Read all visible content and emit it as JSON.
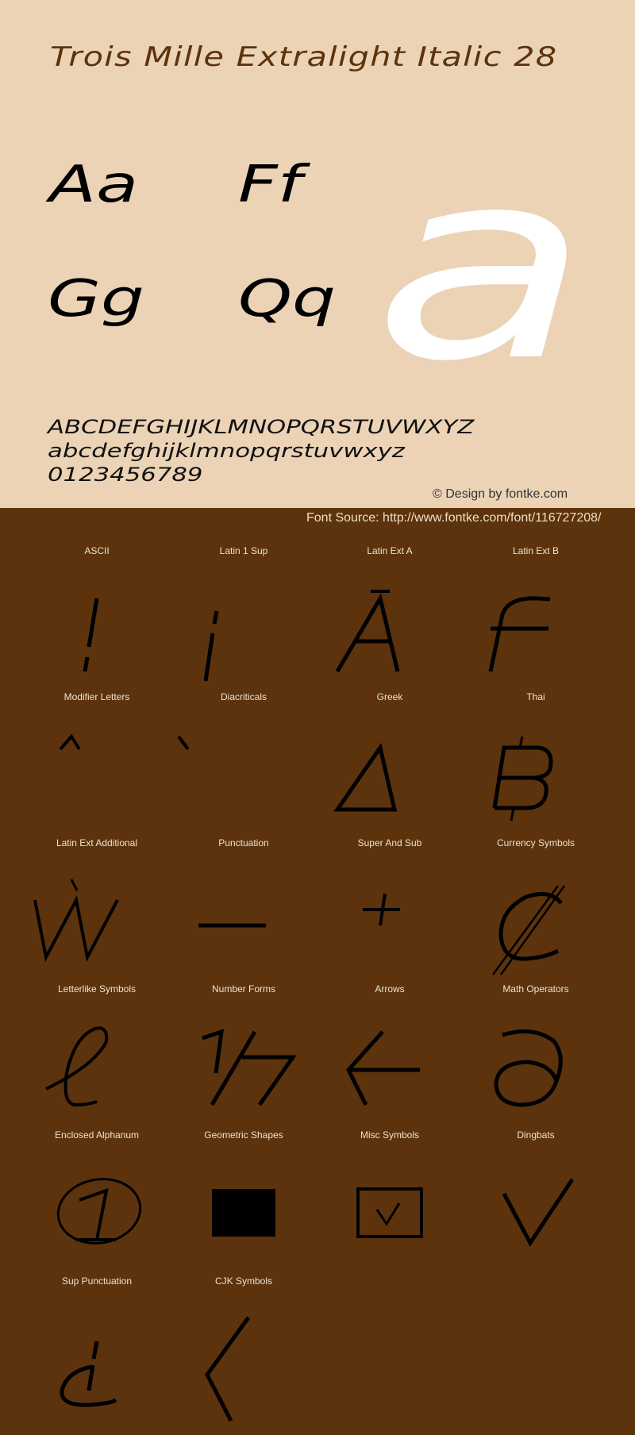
{
  "header": {
    "title": "Trois Mille Extralight Italic 28"
  },
  "specimen": {
    "pairs": [
      "Aa",
      "Ff",
      "Gg",
      "Qq"
    ],
    "large_glyph": "a",
    "uppercase": "ABCDEFGHIJKLMNOPQRSTUVWXYZ",
    "lowercase": "abcdefghijklmnopqrstuvwxyz",
    "digits": "0123456789",
    "credit": "© Design by fontke.com"
  },
  "source": {
    "text": "Font Source: http://www.fontke.com/font/116727208/"
  },
  "colors": {
    "top_background": "#ecd3b6",
    "bottom_background": "#5c330c",
    "title_color": "#5c330c",
    "large_glyph_color": "#ffffff"
  },
  "categories": [
    {
      "label": "ASCII",
      "glyph": "!"
    },
    {
      "label": "Latin 1 Sup",
      "glyph": "¡"
    },
    {
      "label": "Latin Ext A",
      "glyph": "Ā"
    },
    {
      "label": "Latin Ext B",
      "glyph": "ƒ"
    },
    {
      "label": "Modifier Letters",
      "glyph": "ˆ"
    },
    {
      "label": "Diacriticals",
      "glyph": "̀"
    },
    {
      "label": "Greek",
      "glyph": "Δ"
    },
    {
      "label": "Thai",
      "glyph": "฿"
    },
    {
      "label": "Latin Ext Additional",
      "glyph": "Ẁ"
    },
    {
      "label": "Punctuation",
      "glyph": "–"
    },
    {
      "label": "Super And Sub",
      "glyph": "⁺"
    },
    {
      "label": "Currency Symbols",
      "glyph": "₡"
    },
    {
      "label": "Letterlike Symbols",
      "glyph": "ℓ"
    },
    {
      "label": "Number Forms",
      "glyph": "⅐"
    },
    {
      "label": "Arrows",
      "glyph": "←"
    },
    {
      "label": "Math Operators",
      "glyph": "∂"
    },
    {
      "label": "Enclosed Alphanum",
      "glyph": "①"
    },
    {
      "label": "Geometric Shapes",
      "glyph": "■"
    },
    {
      "label": "Misc Symbols",
      "glyph": "☑"
    },
    {
      "label": "Dingbats",
      "glyph": "✓"
    },
    {
      "label": "Sup Punctuation",
      "glyph": "⸘"
    },
    {
      "label": "CJK Symbols",
      "glyph": "〈"
    }
  ]
}
